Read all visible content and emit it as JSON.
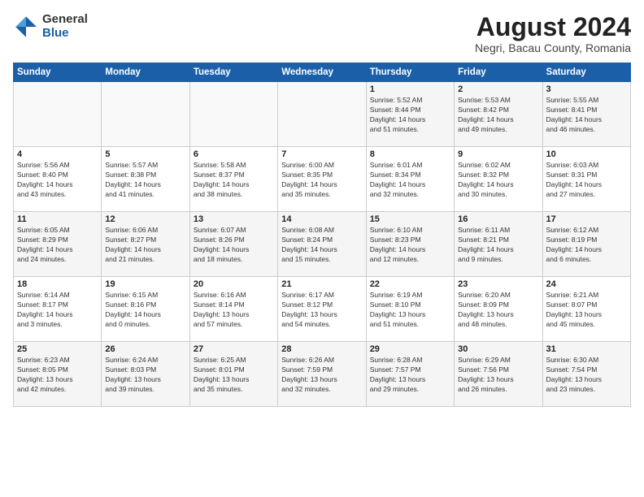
{
  "logo": {
    "general": "General",
    "blue": "Blue"
  },
  "header": {
    "title": "August 2024",
    "subtitle": "Negri, Bacau County, Romania"
  },
  "weekdays": [
    "Sunday",
    "Monday",
    "Tuesday",
    "Wednesday",
    "Thursday",
    "Friday",
    "Saturday"
  ],
  "weeks": [
    [
      {
        "day": "",
        "info": ""
      },
      {
        "day": "",
        "info": ""
      },
      {
        "day": "",
        "info": ""
      },
      {
        "day": "",
        "info": ""
      },
      {
        "day": "1",
        "info": "Sunrise: 5:52 AM\nSunset: 8:44 PM\nDaylight: 14 hours\nand 51 minutes."
      },
      {
        "day": "2",
        "info": "Sunrise: 5:53 AM\nSunset: 8:42 PM\nDaylight: 14 hours\nand 49 minutes."
      },
      {
        "day": "3",
        "info": "Sunrise: 5:55 AM\nSunset: 8:41 PM\nDaylight: 14 hours\nand 46 minutes."
      }
    ],
    [
      {
        "day": "4",
        "info": "Sunrise: 5:56 AM\nSunset: 8:40 PM\nDaylight: 14 hours\nand 43 minutes."
      },
      {
        "day": "5",
        "info": "Sunrise: 5:57 AM\nSunset: 8:38 PM\nDaylight: 14 hours\nand 41 minutes."
      },
      {
        "day": "6",
        "info": "Sunrise: 5:58 AM\nSunset: 8:37 PM\nDaylight: 14 hours\nand 38 minutes."
      },
      {
        "day": "7",
        "info": "Sunrise: 6:00 AM\nSunset: 8:35 PM\nDaylight: 14 hours\nand 35 minutes."
      },
      {
        "day": "8",
        "info": "Sunrise: 6:01 AM\nSunset: 8:34 PM\nDaylight: 14 hours\nand 32 minutes."
      },
      {
        "day": "9",
        "info": "Sunrise: 6:02 AM\nSunset: 8:32 PM\nDaylight: 14 hours\nand 30 minutes."
      },
      {
        "day": "10",
        "info": "Sunrise: 6:03 AM\nSunset: 8:31 PM\nDaylight: 14 hours\nand 27 minutes."
      }
    ],
    [
      {
        "day": "11",
        "info": "Sunrise: 6:05 AM\nSunset: 8:29 PM\nDaylight: 14 hours\nand 24 minutes."
      },
      {
        "day": "12",
        "info": "Sunrise: 6:06 AM\nSunset: 8:27 PM\nDaylight: 14 hours\nand 21 minutes."
      },
      {
        "day": "13",
        "info": "Sunrise: 6:07 AM\nSunset: 8:26 PM\nDaylight: 14 hours\nand 18 minutes."
      },
      {
        "day": "14",
        "info": "Sunrise: 6:08 AM\nSunset: 8:24 PM\nDaylight: 14 hours\nand 15 minutes."
      },
      {
        "day": "15",
        "info": "Sunrise: 6:10 AM\nSunset: 8:23 PM\nDaylight: 14 hours\nand 12 minutes."
      },
      {
        "day": "16",
        "info": "Sunrise: 6:11 AM\nSunset: 8:21 PM\nDaylight: 14 hours\nand 9 minutes."
      },
      {
        "day": "17",
        "info": "Sunrise: 6:12 AM\nSunset: 8:19 PM\nDaylight: 14 hours\nand 6 minutes."
      }
    ],
    [
      {
        "day": "18",
        "info": "Sunrise: 6:14 AM\nSunset: 8:17 PM\nDaylight: 14 hours\nand 3 minutes."
      },
      {
        "day": "19",
        "info": "Sunrise: 6:15 AM\nSunset: 8:16 PM\nDaylight: 14 hours\nand 0 minutes."
      },
      {
        "day": "20",
        "info": "Sunrise: 6:16 AM\nSunset: 8:14 PM\nDaylight: 13 hours\nand 57 minutes."
      },
      {
        "day": "21",
        "info": "Sunrise: 6:17 AM\nSunset: 8:12 PM\nDaylight: 13 hours\nand 54 minutes."
      },
      {
        "day": "22",
        "info": "Sunrise: 6:19 AM\nSunset: 8:10 PM\nDaylight: 13 hours\nand 51 minutes."
      },
      {
        "day": "23",
        "info": "Sunrise: 6:20 AM\nSunset: 8:09 PM\nDaylight: 13 hours\nand 48 minutes."
      },
      {
        "day": "24",
        "info": "Sunrise: 6:21 AM\nSunset: 8:07 PM\nDaylight: 13 hours\nand 45 minutes."
      }
    ],
    [
      {
        "day": "25",
        "info": "Sunrise: 6:23 AM\nSunset: 8:05 PM\nDaylight: 13 hours\nand 42 minutes."
      },
      {
        "day": "26",
        "info": "Sunrise: 6:24 AM\nSunset: 8:03 PM\nDaylight: 13 hours\nand 39 minutes."
      },
      {
        "day": "27",
        "info": "Sunrise: 6:25 AM\nSunset: 8:01 PM\nDaylight: 13 hours\nand 35 minutes."
      },
      {
        "day": "28",
        "info": "Sunrise: 6:26 AM\nSunset: 7:59 PM\nDaylight: 13 hours\nand 32 minutes."
      },
      {
        "day": "29",
        "info": "Sunrise: 6:28 AM\nSunset: 7:57 PM\nDaylight: 13 hours\nand 29 minutes."
      },
      {
        "day": "30",
        "info": "Sunrise: 6:29 AM\nSunset: 7:56 PM\nDaylight: 13 hours\nand 26 minutes."
      },
      {
        "day": "31",
        "info": "Sunrise: 6:30 AM\nSunset: 7:54 PM\nDaylight: 13 hours\nand 23 minutes."
      }
    ]
  ]
}
